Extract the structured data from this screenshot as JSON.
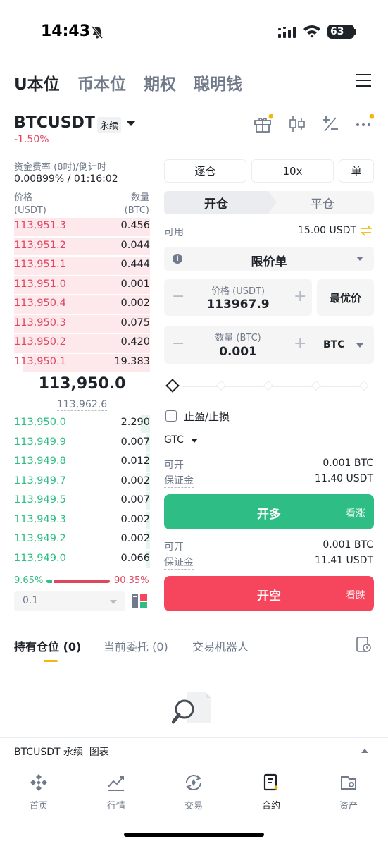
{
  "status": {
    "time": "14:43",
    "battery": "63"
  },
  "top_tabs": [
    "U本位",
    "币本位",
    "期权",
    "聪明钱"
  ],
  "symbol": {
    "name": "BTCUSDT",
    "tag": "永续",
    "change": "-1.50%"
  },
  "funding": {
    "label": "资金费率 (8时)/倒计时",
    "value": "0.00899% / 01:16:02"
  },
  "orderbook": {
    "price_header": "价格",
    "price_unit": "(USDT)",
    "qty_header": "数量",
    "qty_unit": "(BTC)",
    "asks": [
      {
        "price": "113,951.3",
        "qty": "0.456"
      },
      {
        "price": "113,951.2",
        "qty": "0.044"
      },
      {
        "price": "113,951.1",
        "qty": "0.444"
      },
      {
        "price": "113,951.0",
        "qty": "0.001"
      },
      {
        "price": "113,950.4",
        "qty": "0.002"
      },
      {
        "price": "113,950.3",
        "qty": "0.075"
      },
      {
        "price": "113,950.2",
        "qty": "0.420"
      },
      {
        "price": "113,950.1",
        "qty": "19.383"
      }
    ],
    "mid_price": "113,950.0",
    "mark_price": "113,962.6",
    "bids": [
      {
        "price": "113,950.0",
        "qty": "2.290"
      },
      {
        "price": "113,949.9",
        "qty": "0.007"
      },
      {
        "price": "113,949.8",
        "qty": "0.012"
      },
      {
        "price": "113,949.7",
        "qty": "0.002"
      },
      {
        "price": "113,949.5",
        "qty": "0.007"
      },
      {
        "price": "113,949.3",
        "qty": "0.002"
      },
      {
        "price": "113,949.2",
        "qty": "0.002"
      },
      {
        "price": "113,949.0",
        "qty": "0.066"
      }
    ],
    "buy_ratio": "9.65%",
    "sell_ratio": "90.35%",
    "step": "0.1"
  },
  "order_form": {
    "margin_mode": "逐仓",
    "leverage": "10x",
    "position_mode": "单",
    "tab_open": "开仓",
    "tab_close": "平仓",
    "available_label": "可用",
    "available_value": "15.00 USDT",
    "order_type": "限价单",
    "price_label": "价格 (USDT)",
    "price_value": "113967.9",
    "best_price": "最优价",
    "qty_label": "数量 (BTC)",
    "qty_value": "0.001",
    "qty_unit": "BTC",
    "tpsl_label": "止盈/止损",
    "tif": "GTC",
    "long": {
      "open_label": "可开",
      "open_value": "0.001 BTC",
      "margin_label": "保证金",
      "margin_value": "11.40 USDT",
      "button": "开多",
      "button_sub": "看涨"
    },
    "short": {
      "open_label": "可开",
      "open_value": "0.001 BTC",
      "margin_label": "保证金",
      "margin_value": "11.41 USDT",
      "button": "开空",
      "button_sub": "看跌"
    }
  },
  "positions_tabs": [
    "持有仓位 (0)",
    "当前委托 (0)",
    "交易机器人"
  ],
  "chart_bar_label": "BTCUSDT 永续  图表",
  "bottom_nav": [
    "首页",
    "行情",
    "交易",
    "合约",
    "资产"
  ],
  "colors": {
    "buy": "#2ebd85",
    "sell": "#f6465d",
    "accent": "#f0b90b"
  }
}
